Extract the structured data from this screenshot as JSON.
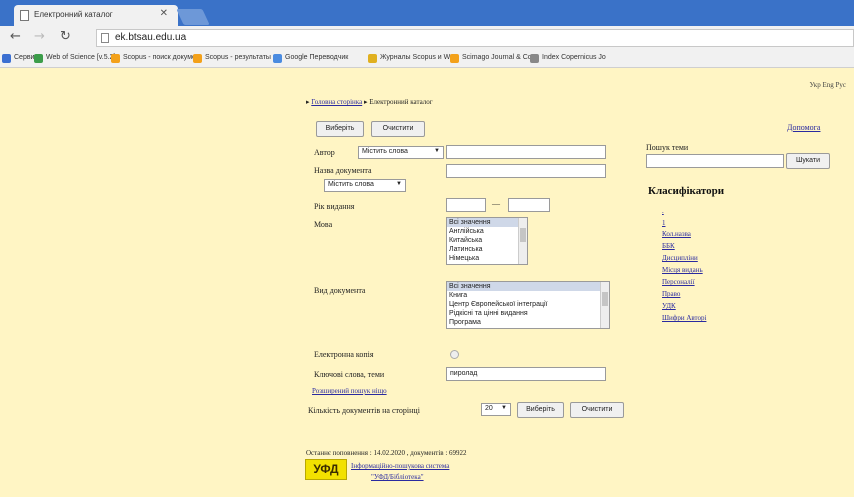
{
  "browser": {
    "tab_title": "Електронний каталог",
    "url": "ek.btsau.edu.ua",
    "bookmarks": [
      "Сервисы",
      "Web of Science [v.5.2]",
      "Scopus - поиск докуме",
      "Scopus - результаты г",
      "Google Переводчик",
      "Журналы Scopus и W",
      "Scimago Journal & Cou",
      "Index Copernicus Jo"
    ],
    "bookmark_colors": [
      "#3b6fd1",
      "#3c9d4a",
      "#f3a11a",
      "#f3a11a",
      "#4a8be0",
      "#e0b020",
      "#f3a11a",
      "#888888"
    ]
  },
  "page": {
    "lang_links": "Укр Eng Рус",
    "breadcrumb": {
      "home": "Головна сторінка",
      "current": "Електронний каталог"
    },
    "buttons": {
      "search": "Виберіть",
      "clear": "Очистити",
      "help": "Допомога"
    },
    "fields": {
      "author_label": "Автор",
      "author_mode": "Містить слова",
      "author_value": "",
      "title_label": "Назва документа",
      "title_mode": "Містить слова",
      "title_value": "",
      "year_label": "Рік видання",
      "year_sep": "—",
      "lang_label": "Мова",
      "lang_options": [
        "Всі значення",
        "Англійська",
        "Китайська",
        "Латинська",
        "Німецька"
      ],
      "doctype_label": "Вид документа",
      "doctype_options": [
        "Всі значення",
        "Книга",
        "Центр Європейської інтеграції",
        "Рідкісні та цінні видання",
        "Програма"
      ],
      "etext_label": "Електронна копія",
      "keywords_label": "Ключові слова, теми",
      "keywords_value": "пиролад"
    },
    "extended_link": "Розширений пошук ніщо",
    "per_page_label": "Кількість документів на сторінці",
    "per_page_value": "20",
    "stats": "Останнє поповнення : 14.02.2020 , документів : 69922",
    "logo_text": "УФД",
    "system_name_1": "Інформаційно-пошукова система",
    "system_name_2": "\"УФД/Бібліотека\""
  },
  "sidebar": {
    "heading_label": "Пошук теми",
    "find_button": "Шукати",
    "classifiers_title": "Класифікатори",
    "classifiers": [
      ".",
      "1",
      "Кол.назва",
      "ББК",
      "Дисципліни",
      "Місця видань",
      "Персоналії",
      "Право",
      "УДК",
      "Шифри Авторі"
    ]
  }
}
